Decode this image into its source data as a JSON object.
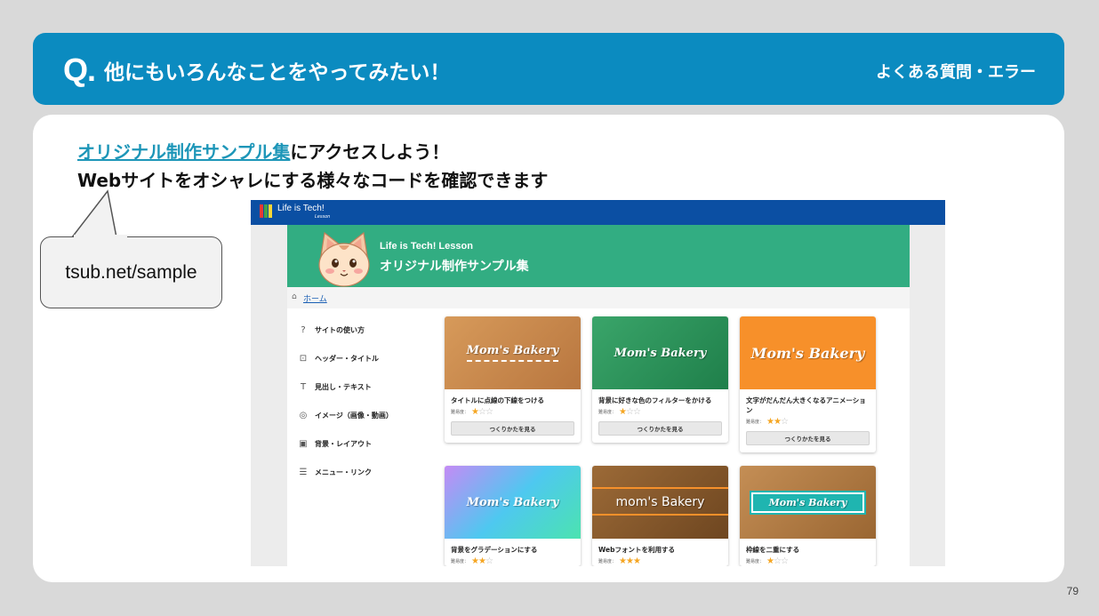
{
  "header": {
    "q_mark": "Q.",
    "title": "他にもいろんなことをやってみたい！",
    "category": "よくある質問・エラー"
  },
  "intro": {
    "link_text": "オリジナル制作サンプル集",
    "line1_rest": "にアクセスしよう！",
    "line2": "Webサイトをオシャレにする様々なコードを確認できます"
  },
  "bubble": {
    "url": "tsub.net/sample"
  },
  "screenshot": {
    "logo_text": "Life is Tech!",
    "logo_sub": "Lesson",
    "banner_sub": "Life is Tech! Lesson",
    "banner_title": "オリジナル制作サンプル集",
    "breadcrumb_home": "ホーム",
    "menu": [
      {
        "icon": "question-circle-icon",
        "label": "サイトの使い方"
      },
      {
        "icon": "header-icon",
        "label": "ヘッダー・タイトル"
      },
      {
        "icon": "text-size-icon",
        "label": "見出し・テキスト"
      },
      {
        "icon": "camera-icon",
        "label": "イメージ（画像・動画）"
      },
      {
        "icon": "background-icon",
        "label": "背景・レイアウト"
      },
      {
        "icon": "list-icon",
        "label": "メニュー・リンク"
      }
    ],
    "difficulty_label": "難易度：",
    "button_label": "つくりかたを見る",
    "cards": [
      {
        "title": "タイトルに点線の下線をつける",
        "thumb_label": "Mom's Bakery",
        "stars": 1,
        "bg": "#c98a4a"
      },
      {
        "title": "背景に好きな色のフィルターをかける",
        "thumb_label": "Mom's Bakery",
        "stars": 1,
        "bg": "#2f9b5e"
      },
      {
        "title": "文字がだんだん大きくなるアニメーション",
        "thumb_label": "Mom's Bakery",
        "stars": 2,
        "bg": "#f7902a"
      },
      {
        "title": "背景をグラデーションにする",
        "thumb_label": "Mom's Bakery",
        "stars": 2,
        "bg": "#7fa6f0"
      },
      {
        "title": "Webフォントを利用する",
        "thumb_label": "mom's Bakery",
        "stars": 3,
        "bg": "#8a5a2b"
      },
      {
        "title": "枠線を二重にする",
        "thumb_label": "Mom's Bakery",
        "stars": 1,
        "bg": "#b07a44"
      }
    ]
  },
  "page_number": "79",
  "colors": {
    "header_bg": "#0b8bc0",
    "banner_bg": "#32ad82",
    "topbar_bg": "#0b4fa3",
    "link": "#1d96b8"
  }
}
